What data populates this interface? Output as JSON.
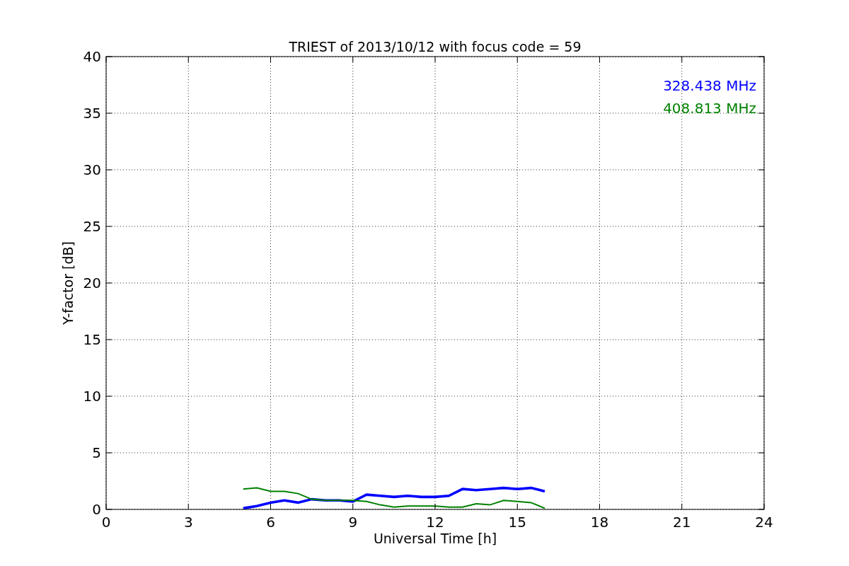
{
  "figure": {
    "chart_data": {
      "type": "line",
      "title": "TRIEST of 2013/10/12 with focus code = 59",
      "xlabel": "Universal Time [h]",
      "ylabel": "Y-factor [dB]",
      "x": [
        5,
        5.5,
        6,
        6.5,
        7,
        7.5,
        8,
        8.5,
        9,
        9.5,
        10,
        10.5,
        11,
        11.5,
        12,
        12.5,
        13,
        13.5,
        14,
        14.5,
        15,
        15.5,
        16
      ],
      "series": [
        {
          "name": "328.438 MHz",
          "color": "#0000ff",
          "values": [
            0.1,
            0.3,
            0.6,
            0.8,
            0.6,
            0.9,
            0.8,
            0.8,
            0.7,
            1.3,
            1.2,
            1.1,
            1.2,
            1.1,
            1.1,
            1.2,
            1.8,
            1.7,
            1.8,
            1.9,
            1.8,
            1.9,
            1.6
          ]
        },
        {
          "name": "408.813 MHz",
          "color": "#008000",
          "values": [
            1.8,
            1.9,
            1.6,
            1.6,
            1.4,
            0.9,
            0.8,
            0.8,
            0.8,
            0.7,
            0.4,
            0.2,
            0.3,
            0.3,
            0.3,
            0.2,
            0.2,
            0.5,
            0.4,
            0.8,
            0.7,
            0.6,
            0.1
          ]
        }
      ],
      "xlim": [
        0,
        24
      ],
      "ylim": [
        0,
        40
      ],
      "xticks": [
        0,
        3,
        6,
        9,
        12,
        15,
        18,
        21,
        24
      ],
      "yticks": [
        0,
        5,
        10,
        15,
        20,
        25,
        30,
        35,
        40
      ],
      "grid": true
    }
  }
}
